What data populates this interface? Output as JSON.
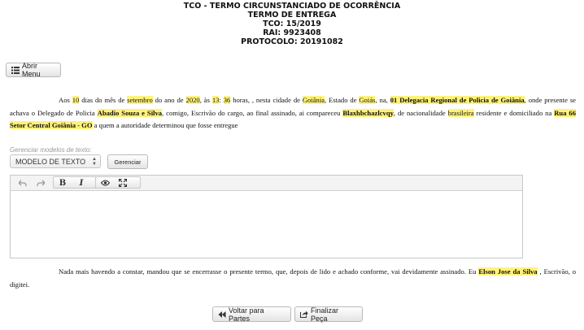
{
  "header": {
    "line1": "TCO - TERMO CIRCUNSTANCIADO DE OCORRÊNCIA",
    "line2": "TERMO DE ENTREGA",
    "line3": "TCO: 15/2019",
    "line4": "RAI: 9923408",
    "line5": "PROTOCOLO: 20191082"
  },
  "menu_button": {
    "label": "Abrir Menu",
    "icon": "list-icon"
  },
  "paragraph1": {
    "t1": "Aos ",
    "day": "10",
    "t2": " dias do mês de ",
    "month": "setembro",
    "t3": " do ano de ",
    "year": "2020",
    "t4": ", às ",
    "hour": "13",
    "t5": ": ",
    "minute": "36",
    "t6": " horas, , nesta cidade de ",
    "city": "Goiânia",
    "t7": ", Estado de ",
    "state": "Goiás",
    "t8": ", na, ",
    "unit": "01 Delegacia Regional de Policia de Goiânia",
    "t9": ", onde presente se achava o Delegado de Policia ",
    "delegate": "Abadio Souza e Silva",
    "t10": ", comigo, Escrivão do cargo, ao final assinado, ai compareceu ",
    "person": "Blaxhbchazlcvqy",
    "t11": ", de nacionalidade ",
    "nationality": "brasileira",
    "t12": " residente e domiciliado na ",
    "address": "Rua 66 Setor Central Goiânia - GO",
    "t13": " a quem a autoridade determinou que fosse entregue"
  },
  "template_section": {
    "label": "Gerenciar modelos de texto:",
    "select_value": "MODELO DE TEXTO",
    "manage_button": "Gerenciar"
  },
  "editor": {
    "content": "",
    "toolbar": [
      "undo-icon",
      "redo-icon",
      "bold-icon",
      "italic-icon",
      "preview-eye-icon",
      "fullscreen-icon"
    ]
  },
  "paragraph2": {
    "t1": "Nada mais havendo a constar, mandou que se encerrasse o presente termo, que, depois de lido e achado conforme, vai devidamente assinado. Eu ",
    "clerk": "Elson Jose da Silva",
    "t2": " , Escrivão, o digitei."
  },
  "footer": {
    "back_button": "Voltar para Partes",
    "finish_button": "Finalizar Peça"
  },
  "colors": {
    "highlight": "#fff27a"
  }
}
